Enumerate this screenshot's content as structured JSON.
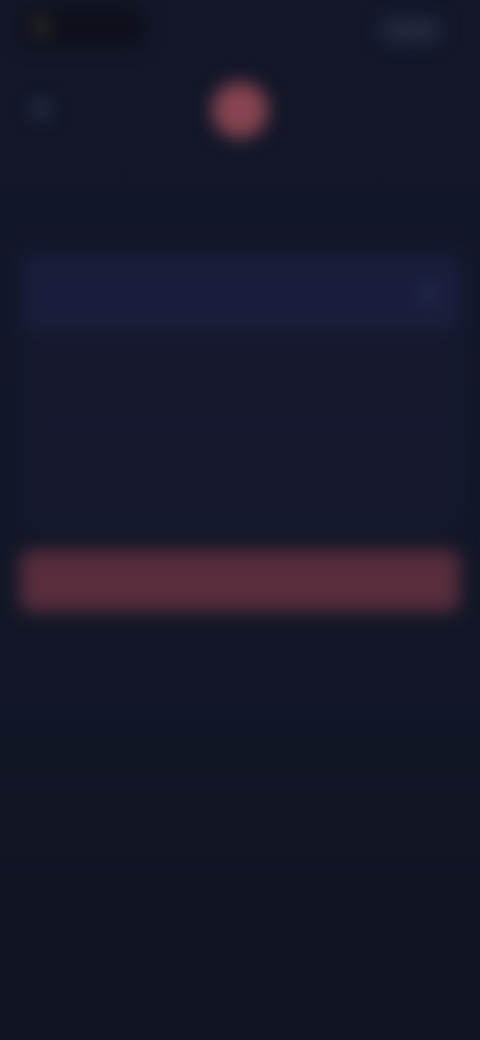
{
  "header": {
    "brand_text": "",
    "action_label": ""
  },
  "nav": {
    "back_icon": "back-arrow-icon",
    "avatar_icon": "avatar"
  },
  "section": {
    "sub_label": "",
    "title": ""
  },
  "form": {
    "rows": [
      {
        "label": ""
      },
      {
        "label": ""
      },
      {
        "label": ""
      }
    ]
  },
  "primary_button": {
    "label": ""
  },
  "colors": {
    "background": "#121625",
    "card": "#181c33",
    "accent": "#6a3545",
    "avatar": "#a4525e"
  }
}
